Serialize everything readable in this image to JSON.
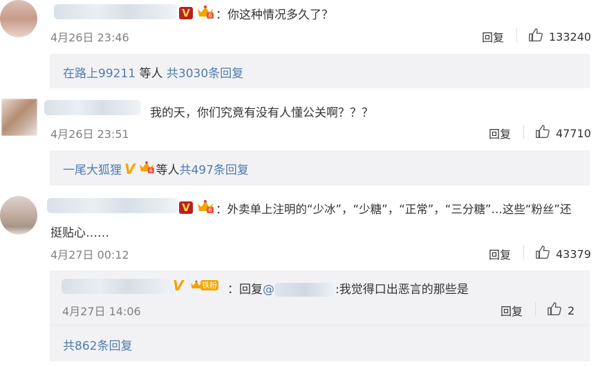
{
  "comments": [
    {
      "text": "：你这种情况多久了？",
      "time": "4月26日 23:46",
      "reply_label": "回复",
      "likes": "133240",
      "replies_summary": {
        "users": "在路上99211",
        "mid": " 等人 ",
        "count": "共3030条回复"
      }
    },
    {
      "text": "我的天，你们究竟有没有人懂公关啊？？？",
      "time": "4月26日 23:51",
      "reply_label": "回复",
      "likes": "47710",
      "replies_summary": {
        "users": "一尾大狐狸",
        "mid": " 等人 ",
        "count": "共497条回复"
      }
    },
    {
      "text_line1": "：外卖单上注明的“少冰”，“少糖”，“正常”，“三分糖”…这些“粉丝”还",
      "text_line2": "挺贴心……",
      "time": "4月27日 00:12",
      "reply_label": "回复",
      "likes": "43379",
      "sub_reply": {
        "prefix": "：回复",
        "mention": "@",
        "text": ":我觉得口出恶言的那些是",
        "time": "4月27日 14:06",
        "reply_label": "回复",
        "likes": "2",
        "badge": "铁粉"
      },
      "replies_summary": {
        "count": "共862条回复"
      }
    }
  ],
  "icons": {
    "like": "thumbs-up-icon",
    "vip": "v-verified-icon",
    "crown": "crown-fan-icon"
  },
  "colors": {
    "link": "#4f7cae",
    "reply_bg": "#f2f2f5",
    "time": "#808080",
    "vbadge": "#b8211f",
    "gold": "#f3a400"
  }
}
